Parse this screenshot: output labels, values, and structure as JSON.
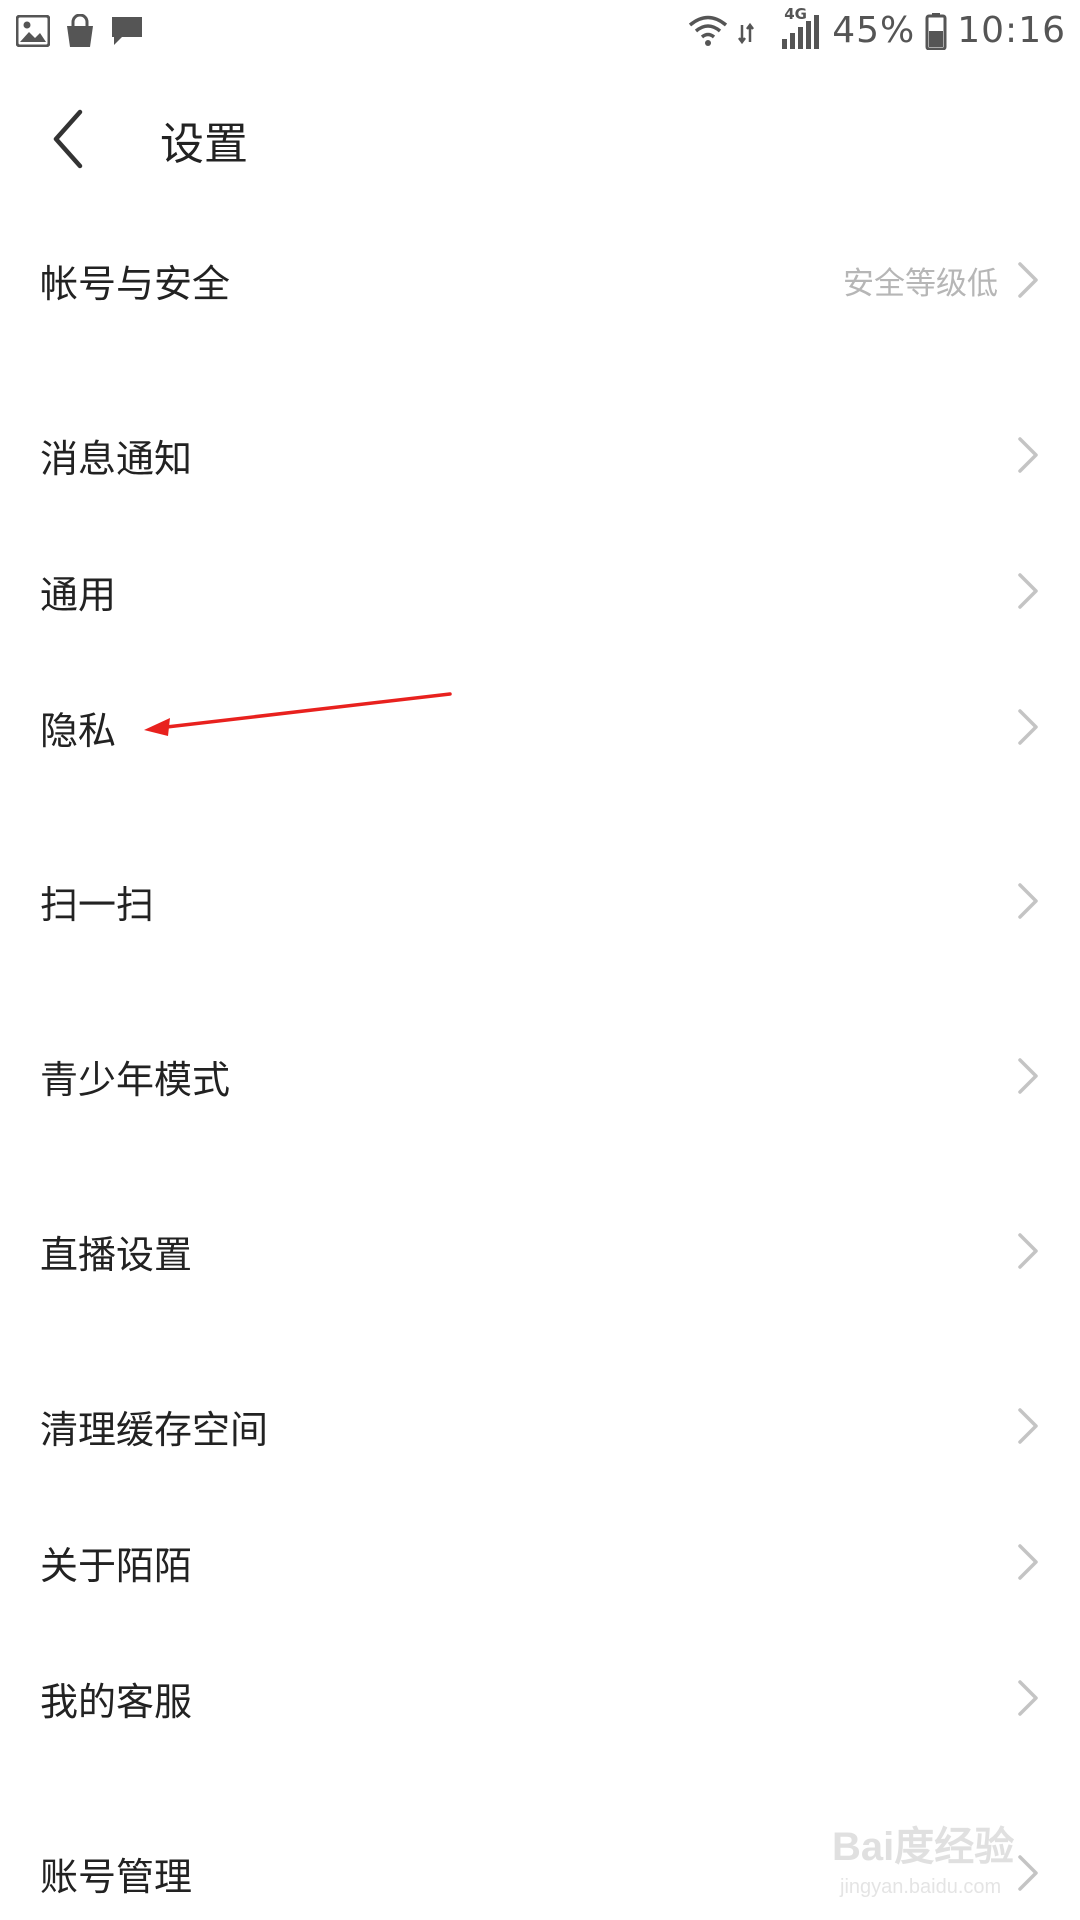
{
  "status_bar": {
    "battery_percent": "45%",
    "time": "10:16",
    "network": "4G",
    "icons_left": [
      "gallery-icon",
      "shopping-bag-icon",
      "message-icon"
    ],
    "icons_right": [
      "wifi-icon",
      "signal-icon",
      "battery-icon"
    ]
  },
  "header": {
    "title": "设置",
    "back_icon": "chevron-left-icon"
  },
  "settings": {
    "items": [
      {
        "label": "帐号与安全",
        "value": "安全等级低"
      },
      {
        "label": "消息通知"
      },
      {
        "label": "通用"
      },
      {
        "label": "隐私"
      },
      {
        "label": "扫一扫"
      },
      {
        "label": "青少年模式"
      },
      {
        "label": "直播设置"
      },
      {
        "label": "清理缓存空间"
      },
      {
        "label": "关于陌陌"
      },
      {
        "label": "我的客服"
      },
      {
        "label": "账号管理"
      }
    ]
  },
  "annotation": {
    "color": "#e8211e"
  },
  "watermark": {
    "main": "Bai度经验",
    "sub": "jingyan.baidu.com"
  }
}
